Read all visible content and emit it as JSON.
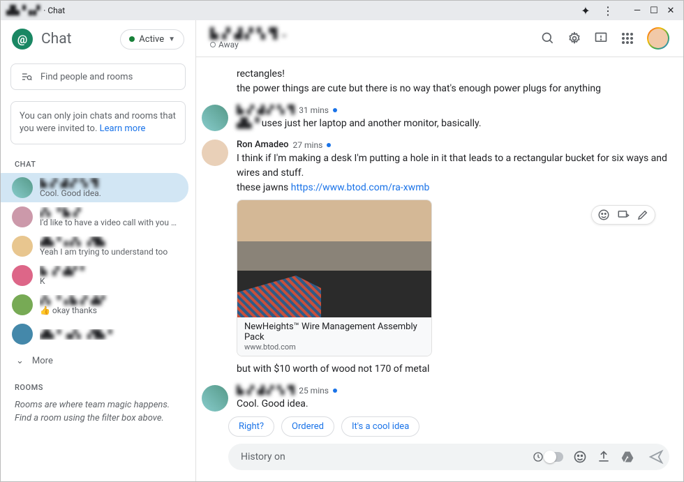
{
  "window": {
    "title_suffix": " · Chat"
  },
  "sidebar": {
    "logo_text": "Chat",
    "active_label": "Active",
    "search_placeholder": "Find people and rooms",
    "info_text": "You can only join chats and rooms that you were invited to. ",
    "info_link": "Learn more",
    "chat_label": "CHAT",
    "rooms_label": "ROOMS",
    "more_label": "More",
    "rooms_hint": "Rooms are where team magic happens. Find a room using the filter box above.",
    "items": [
      {
        "preview": "Cool. Good idea."
      },
      {
        "preview": "I'd like to have a video call with you on ..."
      },
      {
        "preview": "Yeah I am trying to understand too"
      },
      {
        "preview": "K"
      },
      {
        "preview": "👍 okay thanks"
      },
      {
        "preview": ""
      }
    ]
  },
  "header": {
    "away_label": "Away"
  },
  "messages": {
    "m0a": "rectangles!",
    "m0b": "the power things are cute but there is no way that's enough power plugs for anything",
    "m1_time": "31 mins",
    "m1_text_suffix": " uses just her laptop and another monitor, basically.",
    "m2_sender": "Ron Amadeo",
    "m2_time": "27 mins",
    "m2a": "I think if I'm making a desk I'm putting a hole in it that leads to a rectangular bucket for six ways and wires and stuff.",
    "m2b_prefix": "these jawns ",
    "m2b_link": "https://www.btod.com/ra-xwmb",
    "link_card_title": "NewHeights™ Wire Management Assembly Pack",
    "link_card_domain": "www.btod.com",
    "m2c": "but with $10 worth of wood not 170 of metal",
    "m3_time": "25 mins",
    "m3_text": "Cool. Good idea."
  },
  "suggestions": [
    "Right?",
    "Ordered",
    "It's a cool idea"
  ],
  "compose": {
    "placeholder": "History on"
  }
}
